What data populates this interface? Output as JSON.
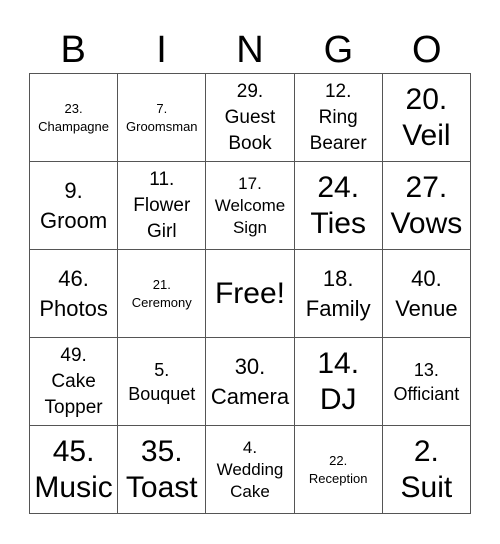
{
  "header": [
    "B",
    "I",
    "N",
    "G",
    "O"
  ],
  "cells": [
    {
      "text": "23.\nChampagne",
      "size": "s"
    },
    {
      "text": "7.\nGroomsman",
      "size": "s"
    },
    {
      "text": "29.\nGuest\nBook",
      "size": "m"
    },
    {
      "text": "12.\nRing\nBearer",
      "size": "m"
    },
    {
      "text": "20.\nVeil",
      "size": "l"
    },
    {
      "text": "9.\nGroom",
      "size": "m2"
    },
    {
      "text": "11.\nFlower\nGirl",
      "size": "m"
    },
    {
      "text": "17.\nWelcome\nSign",
      "size": "s2"
    },
    {
      "text": "24.\nTies",
      "size": "l"
    },
    {
      "text": "27.\nVows",
      "size": "l"
    },
    {
      "text": "46.\nPhotos",
      "size": "m2"
    },
    {
      "text": "21.\nCeremony",
      "size": "s"
    },
    {
      "text": "Free!",
      "size": "l"
    },
    {
      "text": "18.\nFamily",
      "size": "m2"
    },
    {
      "text": "40.\nVenue",
      "size": "m2"
    },
    {
      "text": "49.\nCake\nTopper",
      "size": "m"
    },
    {
      "text": "5.\nBouquet",
      "size": "m3"
    },
    {
      "text": "30.\nCamera",
      "size": "m2"
    },
    {
      "text": "14.\nDJ",
      "size": "l"
    },
    {
      "text": "13.\nOfficiant",
      "size": "m3"
    },
    {
      "text": "45.\nMusic",
      "size": "l"
    },
    {
      "text": "35.\nToast",
      "size": "l"
    },
    {
      "text": "4.\nWedding\nCake",
      "size": "s2"
    },
    {
      "text": "22.\nReception",
      "size": "s"
    },
    {
      "text": "2.\nSuit",
      "size": "l"
    }
  ]
}
